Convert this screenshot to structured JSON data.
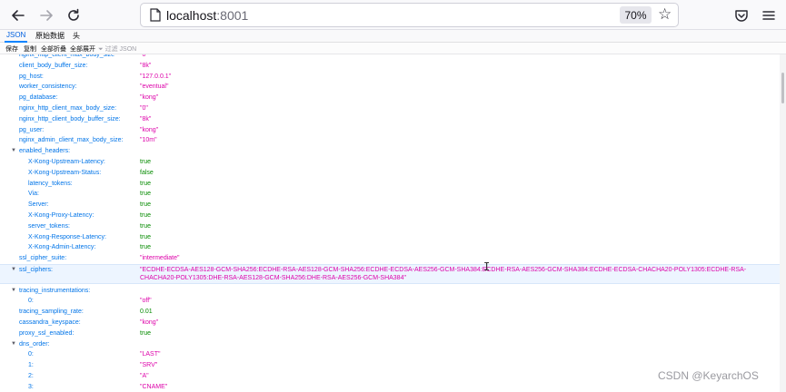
{
  "browser": {
    "url_host": "localhost",
    "url_port": ":8001",
    "zoom": "70%"
  },
  "tabs": [
    {
      "label": "JSON",
      "active": true
    },
    {
      "label": "原始数据",
      "active": false
    },
    {
      "label": "头",
      "active": false
    }
  ],
  "toolbar": {
    "save": "保存",
    "copy": "复制",
    "collapse_all": "全部折叠",
    "expand_all": "全部展开",
    "filter_placeholder": "过滤 JSON"
  },
  "rows": [
    {
      "key": "nginx_http_client_max_body_size",
      "value": "\"0\"",
      "type": "str",
      "indent": 1,
      "y": -5
    },
    {
      "key": "client_body_buffer_size:",
      "value": "\"8k\"",
      "type": "str",
      "indent": 1
    },
    {
      "key": "pg_host:",
      "value": "\"127.0.0.1\"",
      "type": "str",
      "indent": 1
    },
    {
      "key": "worker_consistency:",
      "value": "\"eventual\"",
      "type": "str",
      "indent": 1
    },
    {
      "key": "pg_database:",
      "value": "\"kong\"",
      "type": "str",
      "indent": 1
    },
    {
      "key": "nginx_http_client_max_body_size:",
      "value": "\"0\"",
      "type": "str",
      "indent": 1
    },
    {
      "key": "nginx_http_client_body_buffer_size:",
      "value": "\"8k\"",
      "type": "str",
      "indent": 1
    },
    {
      "key": "pg_user:",
      "value": "\"kong\"",
      "type": "str",
      "indent": 1
    },
    {
      "key": "nginx_admin_client_max_body_size:",
      "value": "\"10m\"",
      "type": "str",
      "indent": 1
    },
    {
      "key": "enabled_headers:",
      "value": "",
      "type": "obj",
      "indent": 1,
      "expanded": true
    },
    {
      "key": "X-Kong-Upstream-Latency:",
      "value": "true",
      "type": "bool",
      "indent": 2
    },
    {
      "key": "X-Kong-Upstream-Status:",
      "value": "false",
      "type": "bool",
      "indent": 2
    },
    {
      "key": "latency_tokens:",
      "value": "true",
      "type": "bool",
      "indent": 2
    },
    {
      "key": "Via:",
      "value": "true",
      "type": "bool",
      "indent": 2
    },
    {
      "key": "Server:",
      "value": "true",
      "type": "bool",
      "indent": 2
    },
    {
      "key": "X-Kong-Proxy-Latency:",
      "value": "true",
      "type": "bool",
      "indent": 2
    },
    {
      "key": "server_tokens:",
      "value": "true",
      "type": "bool",
      "indent": 2
    },
    {
      "key": "X-Kong-Response-Latency:",
      "value": "true",
      "type": "bool",
      "indent": 2
    },
    {
      "key": "X-Kong-Admin-Latency:",
      "value": "true",
      "type": "bool",
      "indent": 2
    },
    {
      "key": "ssl_cipher_suite:",
      "value": "\"intermediate\"",
      "type": "str",
      "indent": 1
    },
    {
      "key": "ssl_ciphers:",
      "value": "\"ECDHE-ECDSA-AES128-GCM-SHA256:ECDHE-RSA-AES128-GCM-SHA256:ECDHE-ECDSA-AES256-GCM-SHA384:ECDHE-RSA-AES256-GCM-SHA384:ECDHE-ECDSA-CHACHA20-POLY1305:ECDHE-RSA-CHACHA20-POLY1305:DHE-RSA-AES128-GCM-SHA256:DHE-RSA-AES256-GCM-SHA384\"",
      "type": "str",
      "indent": 1,
      "highlight": true,
      "expanded": true
    },
    {
      "key": "tracing_instrumentations:",
      "value": "",
      "type": "obj",
      "indent": 1,
      "expanded": true
    },
    {
      "key": "0:",
      "value": "\"off\"",
      "type": "str",
      "indent": 2
    },
    {
      "key": "tracing_sampling_rate:",
      "value": "0.01",
      "type": "num",
      "indent": 1
    },
    {
      "key": "cassandra_keyspace:",
      "value": "\"kong\"",
      "type": "str",
      "indent": 1
    },
    {
      "key": "proxy_ssl_enabled:",
      "value": "true",
      "type": "bool",
      "indent": 1
    },
    {
      "key": "dns_order:",
      "value": "",
      "type": "obj",
      "indent": 1,
      "expanded": true
    },
    {
      "key": "0:",
      "value": "\"LAST\"",
      "type": "str",
      "indent": 2
    },
    {
      "key": "1:",
      "value": "\"SRV\"",
      "type": "str",
      "indent": 2
    },
    {
      "key": "2:",
      "value": "\"A\"",
      "type": "str",
      "indent": 2
    },
    {
      "key": "3:",
      "value": "\"CNAME\"",
      "type": "str",
      "indent": 2
    }
  ],
  "watermark": "CSDN @KeyarchOS"
}
